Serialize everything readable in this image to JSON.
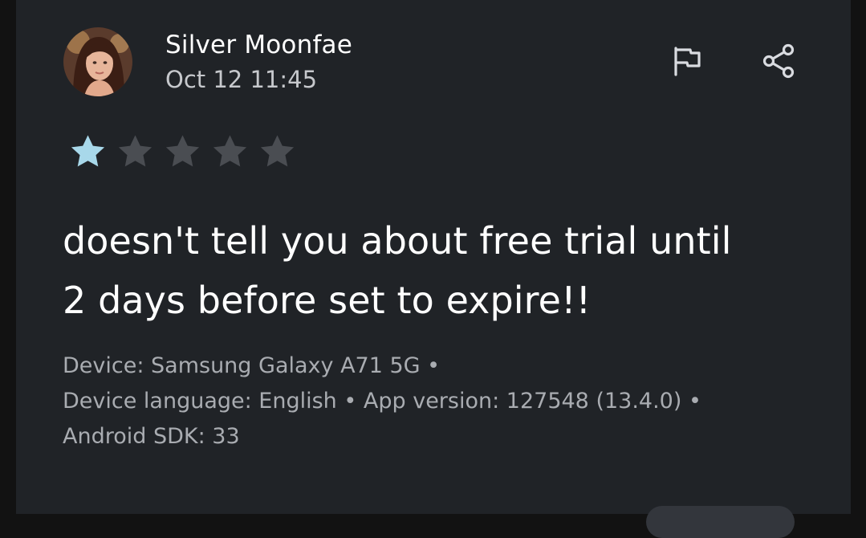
{
  "review": {
    "author": "Silver Moonfae",
    "timestamp": "Oct 12 11:45",
    "rating": 1,
    "rating_max": 5,
    "text_line1": "doesn't tell you about free trial until",
    "text_line2": "2 days before set to expire!!",
    "device_line": "Device: Samsung Galaxy A71 5G •",
    "language_version_line": "Device language: English • App version: 127548 (13.4.0) •",
    "sdk_line": "Android SDK: 33"
  },
  "actions": {
    "flag_icon": "flag-icon",
    "share_icon": "share-icon"
  },
  "colors": {
    "card_background": "#202327",
    "star_filled": "#a8d8ea",
    "star_empty": "#4a4d52",
    "meta_text": "#a9acb1"
  }
}
